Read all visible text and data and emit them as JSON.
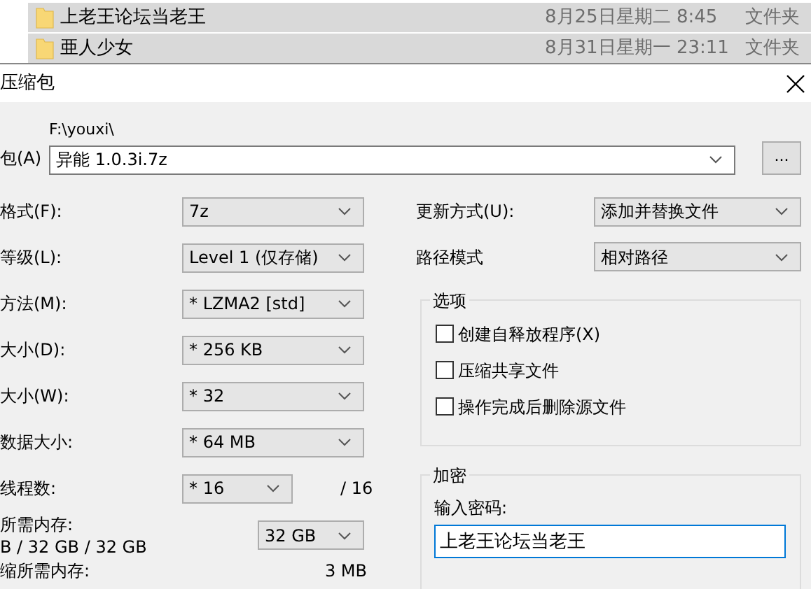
{
  "file_list": [
    {
      "name": "上老王论坛当老王",
      "date": "8月25日星期二 8:45",
      "type": "文件夹",
      "selected": true
    },
    {
      "name": "亜人少女",
      "date": "8月31日星期一 23:11",
      "type": "文件夹",
      "selected": true
    }
  ],
  "dialog": {
    "title": "压缩包"
  },
  "archive": {
    "label": "包(A)",
    "path": "F:\\youxi\\",
    "value": "异能 1.0.3i.7z",
    "browse": "..."
  },
  "left_fields": [
    {
      "kind": "combo",
      "label": "格式(F):",
      "value": "7z"
    },
    {
      "kind": "combo",
      "label": "等级(L):",
      "value": "Level 1 (仅存储)"
    },
    {
      "kind": "combo",
      "label": "方法(M):",
      "value": "* LZMA2 [std]"
    },
    {
      "kind": "combo",
      "label": "大小(D):",
      "value": "* 256 KB"
    },
    {
      "kind": "combo",
      "label": "大小(W):",
      "value": "* 32"
    },
    {
      "kind": "combo",
      "label": "数据大小:",
      "value": "* 64 MB"
    },
    {
      "kind": "threads",
      "label": "线程数:",
      "value": "* 16",
      "suffix": "/ 16"
    }
  ],
  "memory": {
    "label": "所需内存:",
    "detail": "B / 32 GB / 32 GB",
    "value": "32 GB"
  },
  "decompress_memory": {
    "label": "缩所需内存:",
    "value": "3 MB"
  },
  "update_mode": {
    "label": "更新方式(U):",
    "value": "添加并替换文件"
  },
  "path_mode": {
    "label": "路径模式",
    "value": "相对路径"
  },
  "options": {
    "title": "选项",
    "items": [
      {
        "label": "创建自释放程序(X)",
        "checked": false
      },
      {
        "label": "压缩共享文件",
        "checked": false
      },
      {
        "label": "操作完成后删除源文件",
        "checked": false
      }
    ]
  },
  "encryption": {
    "title": "加密",
    "prompt": "输入密码:",
    "value": "上老王论坛当老王"
  }
}
